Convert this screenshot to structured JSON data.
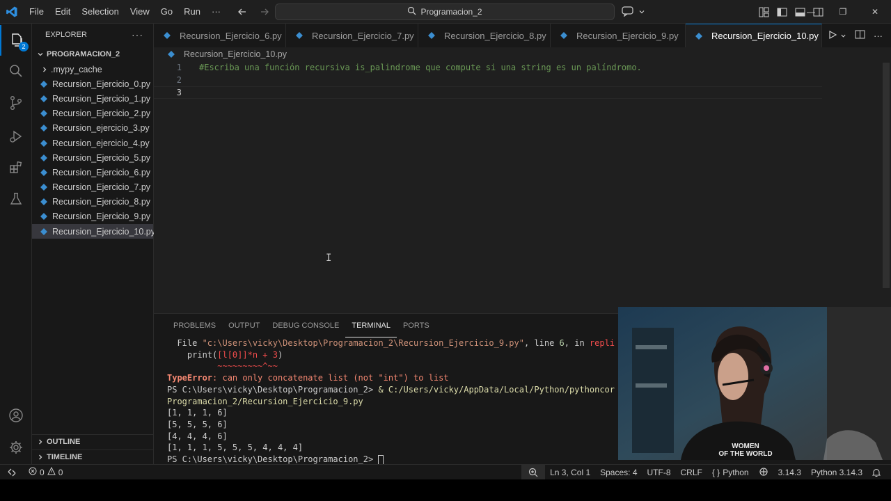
{
  "menu": [
    "File",
    "Edit",
    "Selection",
    "View",
    "Go",
    "Run",
    "···"
  ],
  "search": {
    "text": "Programacion_2"
  },
  "explorer": {
    "title": "EXPLORER",
    "folder": "PROGRAMACION_2",
    "badge": "2",
    "items": [
      {
        "label": ".mypy_cache",
        "type": "folder"
      },
      {
        "label": "Recursion_Ejercicio_0.py",
        "type": "py"
      },
      {
        "label": "Recursion_Ejercicio_1.py",
        "type": "py"
      },
      {
        "label": "Recursion_Ejercicio_2.py",
        "type": "py"
      },
      {
        "label": "Recursion_ejercicio_3.py",
        "type": "py"
      },
      {
        "label": "Recursion_ejercicio_4.py",
        "type": "py"
      },
      {
        "label": "Recursion_Ejercicio_5.py",
        "type": "py"
      },
      {
        "label": "Recursion_Ejercicio_6.py",
        "type": "py"
      },
      {
        "label": "Recursion_Ejercicio_7.py",
        "type": "py"
      },
      {
        "label": "Recursion_Ejercicio_8.py",
        "type": "py"
      },
      {
        "label": "Recursion_Ejercicio_9.py",
        "type": "py"
      },
      {
        "label": "Recursion_Ejercicio_10.py",
        "type": "py"
      }
    ],
    "outline": "OUTLINE",
    "timeline": "TIMELINE"
  },
  "tabs": [
    {
      "label": "Recursion_Ejercicio_6.py"
    },
    {
      "label": "Recursion_Ejercicio_7.py"
    },
    {
      "label": "Recursion_Ejercicio_8.py"
    },
    {
      "label": "Recursion_Ejercicio_9.py"
    },
    {
      "label": "Recursion_Ejercicio_10.py"
    }
  ],
  "breadcrumb": "Recursion_Ejercicio_10.py",
  "editor": {
    "lines": [
      {
        "num": "1",
        "code": "#Escriba una función recursiva is_palindrome que compute si una string es un palíndromo."
      },
      {
        "num": "2",
        "code": ""
      },
      {
        "num": "3",
        "code": ""
      }
    ]
  },
  "panel": {
    "tabs": [
      "PROBLEMS",
      "OUTPUT",
      "DEBUG CONSOLE",
      "TERMINAL",
      "PORTS"
    ],
    "active_tab": "TERMINAL",
    "terminal": {
      "file_line_prefix": "  File ",
      "file_path": "\"c:\\Users\\vicky\\Desktop\\Programacion_2\\Recursion_Ejercicio_9.py\"",
      "file_line_mid": ", line ",
      "file_line_num": "6",
      "file_line_suffix": ", in ",
      "file_line_fn": "repli",
      "print_pre": "    print(",
      "print_arg": "[l[0]]*n + 3",
      "print_post": ")",
      "squiggle": "          ~~~~~~~~~^~~",
      "error_type": "TypeError",
      "error_msg": ": can only concatenate list (not \"int\") to list",
      "prompt1": "PS C:\\Users\\vicky\\Desktop\\Programacion_2> ",
      "cmd1": "& C:/Users/vicky/AppData/Local/Python/pythoncor",
      "cmd1_cont": "Programacion_2/Recursion_Ejercicio_9.py",
      "outputs": [
        "[1, 1, 1, 6]",
        "[5, 5, 5, 6]",
        "[4, 4, 4, 6]",
        "[1, 1, 1, 5, 5, 5, 4, 4, 4]"
      ],
      "prompt2": "PS C:\\Users\\vicky\\Desktop\\Programacion_2> "
    }
  },
  "webcam": {
    "shirt_line1": "WOMEN",
    "shirt_line2": "OF THE WORLD"
  },
  "status": {
    "errors": "0",
    "warnings": "0",
    "position": "Ln 3, Col 1",
    "spaces": "Spaces: 4",
    "encoding": "UTF-8",
    "eol": "CRLF",
    "language": "Python",
    "version": "3.14.3",
    "interpreter": "Python 3.14.3"
  },
  "colors": {
    "accent": "#0078d4",
    "comment": "#6a9955",
    "python_icon": "#3b8ed0"
  }
}
